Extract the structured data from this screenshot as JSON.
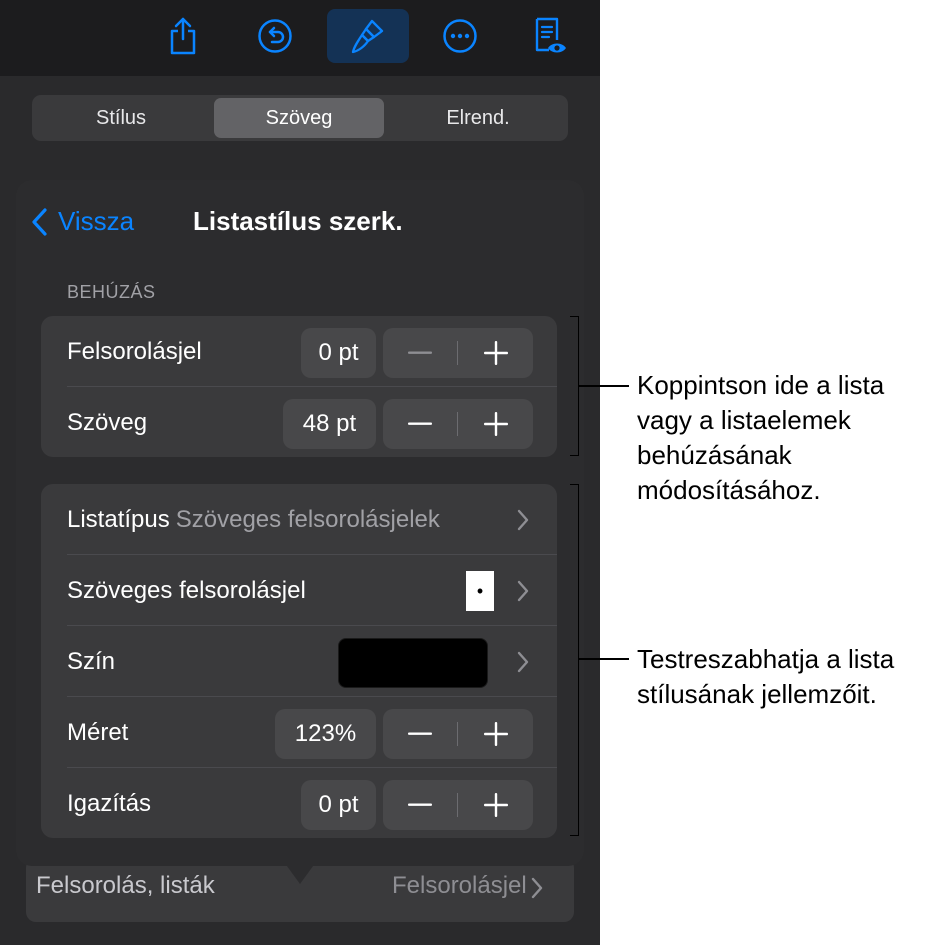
{
  "toolbar": {
    "buttons": [
      {
        "name": "share-icon"
      },
      {
        "name": "undo-icon"
      },
      {
        "name": "format-paintbrush-icon",
        "active": true
      },
      {
        "name": "more-icon"
      },
      {
        "name": "reading-view-icon"
      }
    ],
    "accent": "#0a84ff"
  },
  "tabs": [
    {
      "label": "Stílus"
    },
    {
      "label": "Szöveg",
      "selected": true
    },
    {
      "label": "Elrend."
    }
  ],
  "popover": {
    "back_label": "Vissza",
    "title": "Listastílus szerk.",
    "section_label": "BEHÚZÁS",
    "indent": {
      "bullet": {
        "label": "Felsorolásjel",
        "value": "0 pt"
      },
      "text": {
        "label": "Szöveg",
        "value": "48 pt"
      }
    },
    "style": {
      "list_type": {
        "label": "Listatípus",
        "value": "Szöveges felsorolásjelek"
      },
      "text_bullet": {
        "label": "Szöveges felsorolásjel",
        "value": "•"
      },
      "color": {
        "label": "Szín",
        "swatch": "#000000"
      },
      "size": {
        "label": "Méret",
        "value": "123%"
      },
      "alignment": {
        "label": "Igazítás",
        "value": "0 pt"
      }
    }
  },
  "underlay": {
    "label": "Felsorolás, listák",
    "value": "Felsorolásjel"
  },
  "callouts": {
    "indent": "Koppintson ide a lista vagy a listaelemek behúzásának módosításához.",
    "style": "Testreszabhatja a lista stílusának jellemzőit."
  }
}
